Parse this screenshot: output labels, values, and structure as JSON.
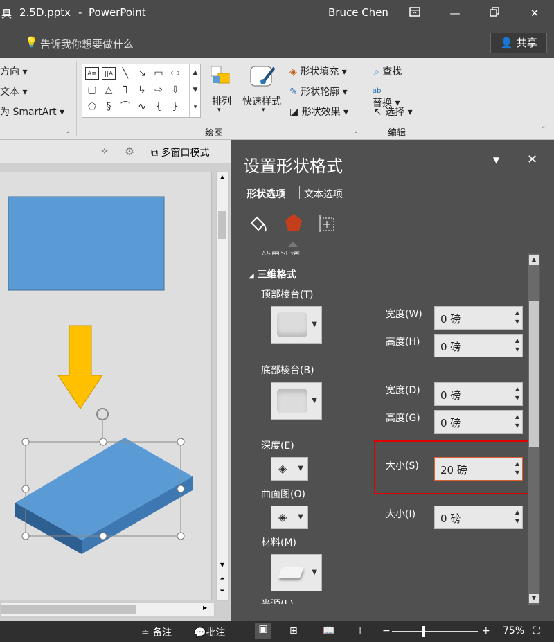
{
  "titlebar": {
    "left_cut": "具",
    "filename": "2.5D.pptx",
    "separator": "-",
    "app": "PowerPoint",
    "user": "Bruce Chen"
  },
  "tellme": {
    "placeholder": "告诉我你想要做什么",
    "share_label": "共享"
  },
  "ribbon": {
    "left_items": [
      "方向",
      "文本",
      "为 SmartArt"
    ],
    "arrange_label": "排列",
    "quickstyles_label": "快速样式",
    "shape_fill": "形状填充",
    "shape_outline": "形状轮廓",
    "shape_effects": "形状效果",
    "find": "查找",
    "replace": "替换",
    "select": "选择",
    "group_drawing": "绘图",
    "group_editing": "编辑"
  },
  "strip": {
    "multiwindow": "多窗口模式"
  },
  "pane": {
    "title": "设置形状格式",
    "tab_shape": "形状选项",
    "tab_text": "文本选项",
    "section_prev": "效果选项",
    "section": "三维格式",
    "top_bevel": "顶部棱台(T)",
    "bottom_bevel": "底部棱台(B)",
    "width_label_1": "宽度(W)",
    "height_label_1": "高度(H)",
    "width_label_2": "宽度(D)",
    "height_label_2": "高度(G)",
    "depth": "深度(E)",
    "depth_size_label": "大小(S)",
    "contour": "曲面图(O)",
    "contour_size_label": "大小(I)",
    "material": "材料(M)",
    "lighting": "光源(L)",
    "top_width": "0 磅",
    "top_height": "0 磅",
    "bottom_width": "0 磅",
    "bottom_height": "0 磅",
    "depth_size": "20 磅",
    "contour_size": "0 磅"
  },
  "status": {
    "notes": "备注",
    "comments": "批注",
    "zoom": "75%"
  },
  "colors": {
    "highlight": "#e00000",
    "shape_blue": "#5b9bd5",
    "arrow_yellow": "#ffc000",
    "pane_bg": "#505050"
  }
}
